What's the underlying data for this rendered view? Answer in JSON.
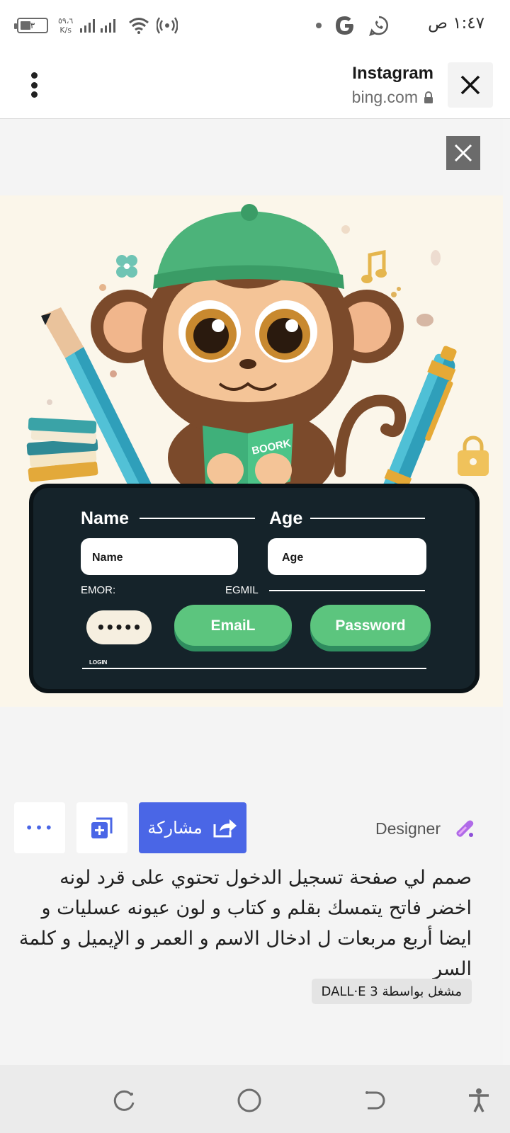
{
  "status_bar": {
    "time": "١:٤٧ ص",
    "battery": "٣",
    "net_speed_value": "٥٩،٦",
    "net_speed_unit": "K/s"
  },
  "header": {
    "title": "Instagram",
    "domain": "bing.com"
  },
  "image_text": {
    "name_heading": "Name",
    "age_heading": "Age",
    "name_field": "Name",
    "age_field": "Age",
    "emor_label": "EMOR:",
    "egmil_label": "EGMIL",
    "password_dots": "•••••",
    "email_button": "EmaiL",
    "password_button": "Password",
    "login_small": "LOGIN",
    "book_label": "BOORK"
  },
  "actions": {
    "more_label": "•••",
    "share_label": "مشاركة",
    "designer_label": "Designer"
  },
  "prompt": {
    "text": "صمم لي صفحة تسجيل الدخول تحتوي على قرد لونه اخضر فاتح يتمسك بقلم و كتاب و لون عيونه عسليات و ايضا أربع مربعات ل ادخال الاسم و العمر و الإيميل و كلمة السر",
    "badge": "مشغل بواسطة DALL·E 3"
  },
  "colors": {
    "accent": "#4a66e6",
    "green": "#5cc57e",
    "panel": "#15232a"
  }
}
